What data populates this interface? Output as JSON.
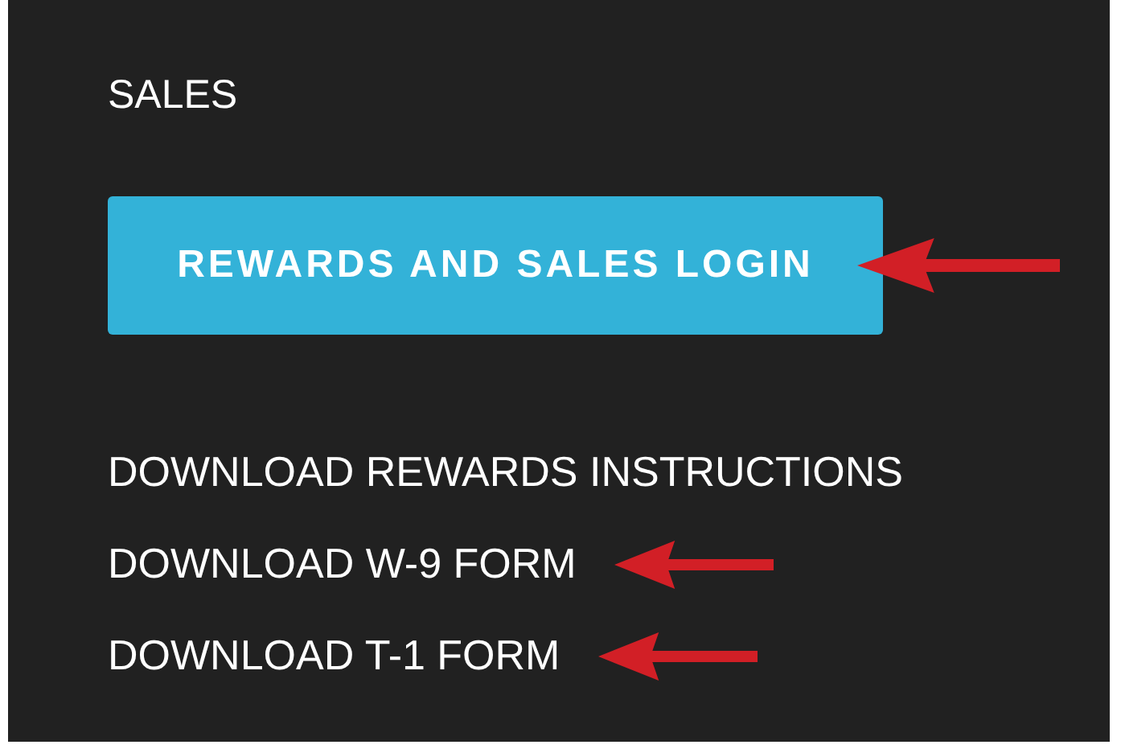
{
  "section": {
    "title": "SALES"
  },
  "button": {
    "label": "REWARDS AND SALES LOGIN",
    "highlighted": true
  },
  "links": [
    {
      "label": "DOWNLOAD REWARDS INSTRUCTIONS",
      "highlighted": false
    },
    {
      "label": "DOWNLOAD W-9 FORM",
      "highlighted": true
    },
    {
      "label": "DOWNLOAD T-1 FORM",
      "highlighted": true
    }
  ]
}
